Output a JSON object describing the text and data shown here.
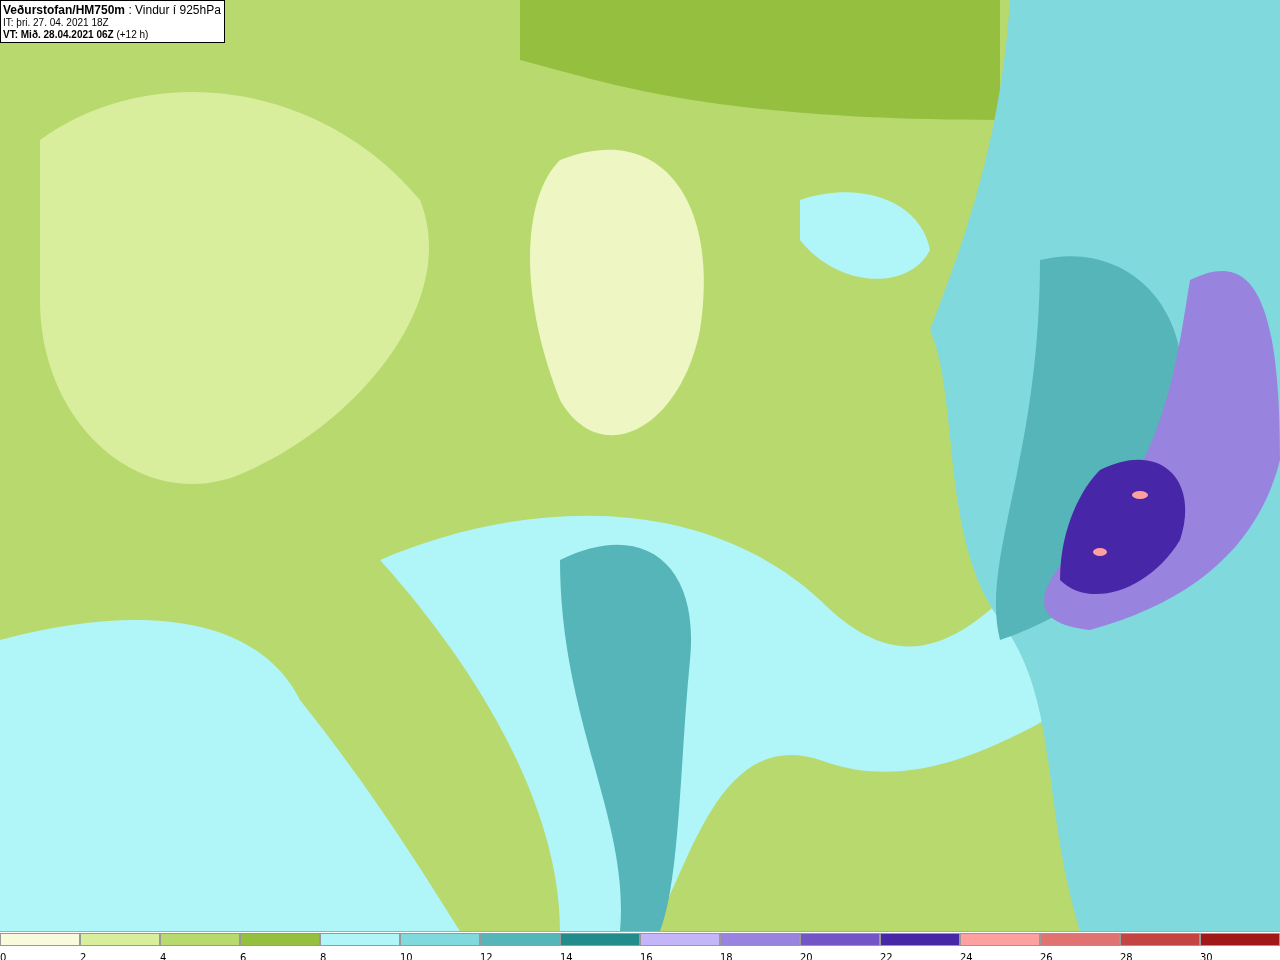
{
  "title_box": {
    "lines": [
      "**Veðurstofan/HM750m** : Vindur í 925hPa",
      "IT: þri. 27. 04. 2021 18Z",
      "**VT: Mið. 28.04.2021 06Z** (+12 h)"
    ]
  },
  "legend": [
    {
      "label": "0",
      "color": "#f7fbdc"
    },
    {
      "label": "2",
      "color": "#d9ee9d"
    },
    {
      "label": "4",
      "color": "#b8d96e"
    },
    {
      "label": "6",
      "color": "#94bf3f"
    },
    {
      "label": "8",
      "color": "#b0f6f8"
    },
    {
      "label": "10",
      "color": "#80d9dc"
    },
    {
      "label": "12",
      "color": "#55b5b8"
    },
    {
      "label": "14",
      "color": "#228b8b"
    },
    {
      "label": "16",
      "color": "#c3b5f8"
    },
    {
      "label": "18",
      "color": "#9884de"
    },
    {
      "label": "20",
      "color": "#7455c6"
    },
    {
      "label": "22",
      "color": "#4726a8"
    },
    {
      "label": "24",
      "color": "#ffa0a0"
    },
    {
      "label": "26",
      "color": "#e07272"
    },
    {
      "label": "28",
      "color": "#c44444"
    },
    {
      "label": "30",
      "color": "#a01818"
    }
  ]
}
